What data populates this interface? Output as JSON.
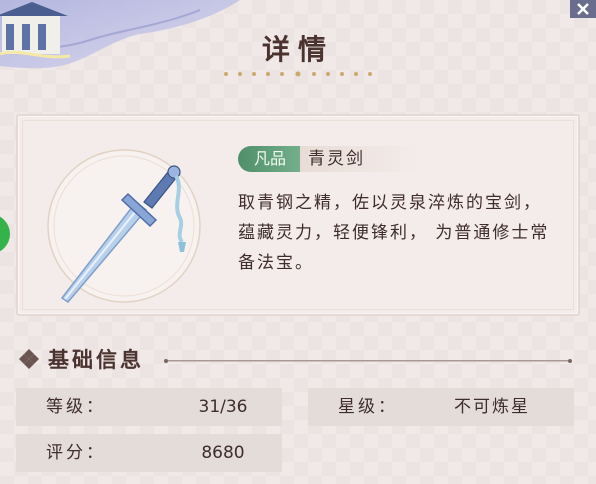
{
  "title": "详情",
  "item": {
    "tier": "凡品",
    "name": "青灵剑",
    "description": "取青钢之精，佐以灵泉淬炼的宝剑，蕴藏灵力，轻便锋利， 为普通修士常备法宝。"
  },
  "basic_info": {
    "header": "基础信息",
    "stats": [
      {
        "label": "等级：",
        "value": "31/36"
      },
      {
        "label": "星级：",
        "value": "不可炼星"
      },
      {
        "label": "评分：",
        "value": "8680"
      }
    ]
  },
  "colors": {
    "tier_badge": "#5f9c75",
    "background": "#ece5e3",
    "text": "#3e2d2a"
  },
  "icons": [
    "pavilion-roof-art",
    "sword-icon",
    "diamond-icon",
    "close-icon"
  ]
}
